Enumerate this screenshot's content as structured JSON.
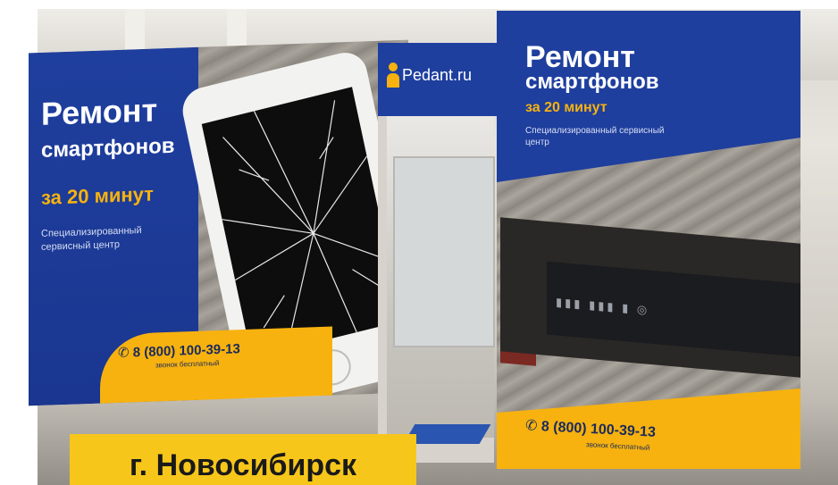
{
  "left_banner": {
    "title": "Ремонт",
    "subtitle": "смартфонов",
    "minutes": "за 20 минут",
    "description": "Специализированный сервисный центр",
    "phone": "8 (800) 100-39-13",
    "phone_note": "звонок бесплатный"
  },
  "door": {
    "logo_text": "Pedant.ru"
  },
  "right_banner": {
    "title": "Ремонт",
    "subtitle": "смартфонов",
    "minutes": "за 20 минут",
    "description": "Специализированный сервисный центр",
    "phone": "8 (800) 100-39-13",
    "phone_note": "звонок бесплатный"
  },
  "caption": {
    "city": "г. Новосибирск"
  },
  "colors": {
    "brand_blue": "#1f3f9e",
    "brand_yellow": "#f7b20f"
  },
  "icons": {
    "phone": "phone-icon",
    "logo": "pedant-person-icon"
  }
}
